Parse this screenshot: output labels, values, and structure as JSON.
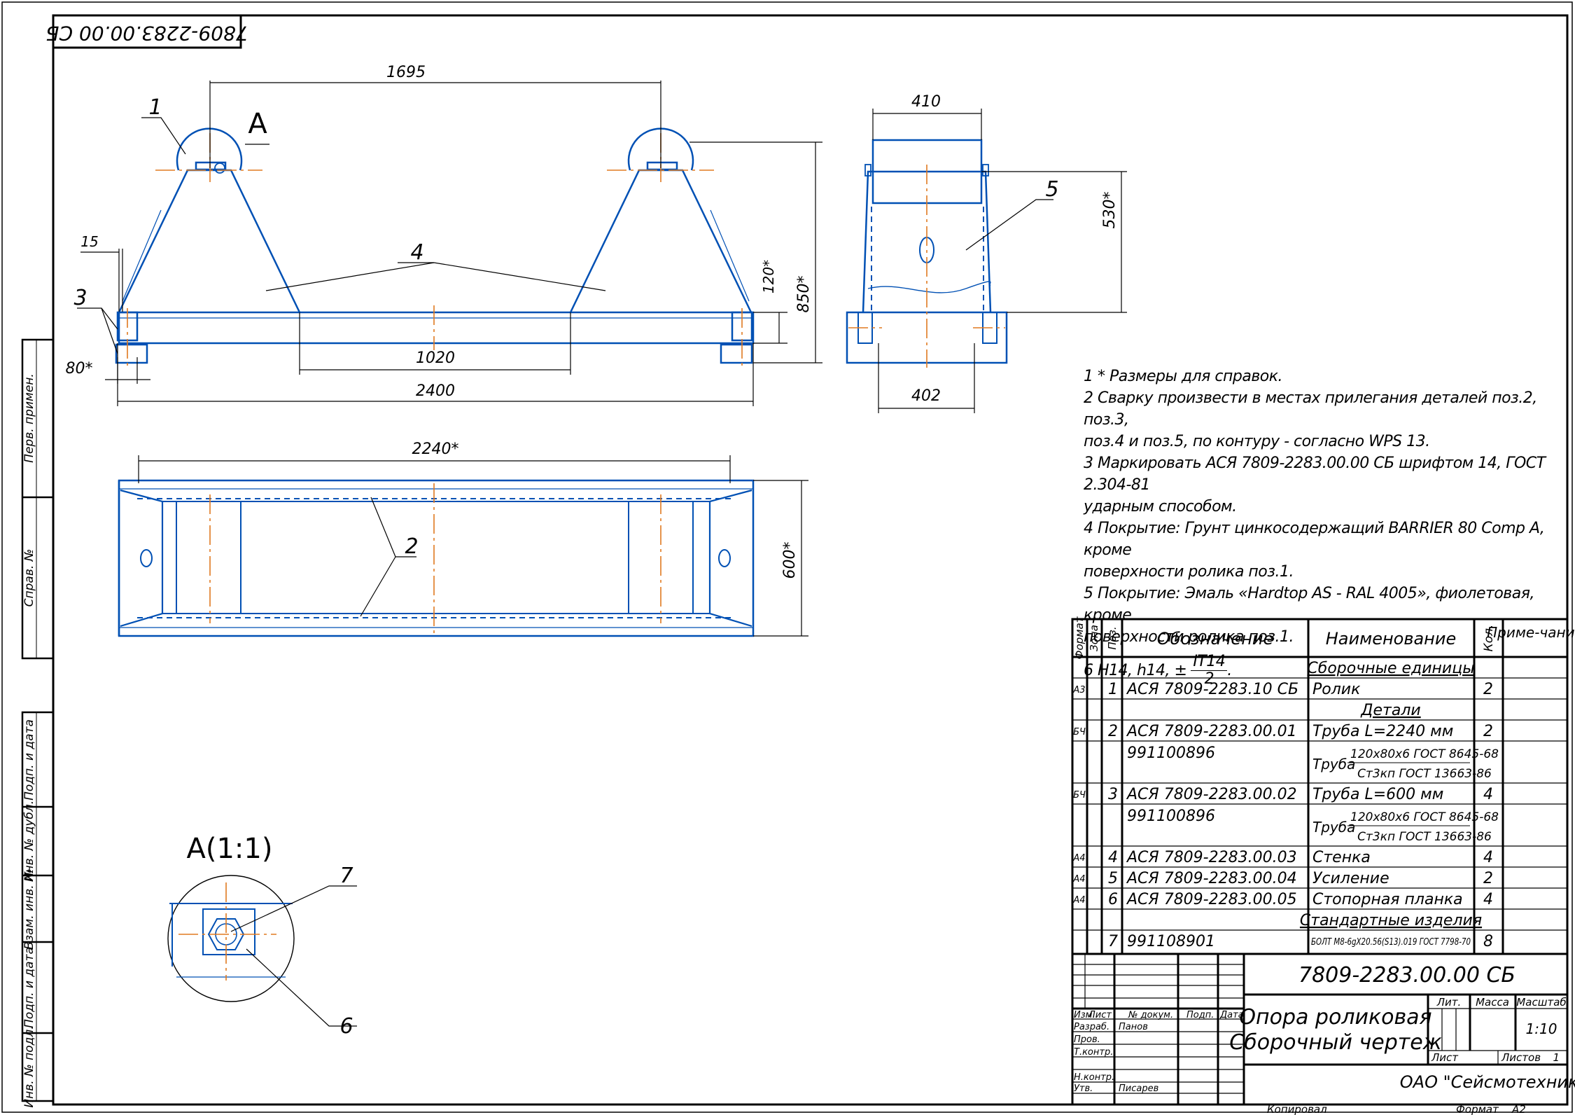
{
  "title_block": {
    "designation": "7809-2283.00.00 СБ",
    "name_line1": "Опора роликовая",
    "name_line2": "Сборочный чертеж",
    "company": "ОАО \"Сейсмотехника\"",
    "lit_label": "Лит.",
    "mass_label": "Масса",
    "scale_label": "Масштаб",
    "scale": "1:10",
    "sheet_label": "Лист",
    "sheets_label": "Листов",
    "sheets_count": "1",
    "izm": "Изм.",
    "list": "Лист",
    "doc_no": "№ докум.",
    "podp": "Подп.",
    "data": "Дата",
    "razrab": "Разраб.",
    "razrab_name": "Панов",
    "prov": "Пров.",
    "tkontr": "Т.контр.",
    "nkontr": "Н.контр.",
    "utv": "Утв.",
    "utv_name": "Писарев",
    "copied": "Копировал",
    "format_label": "Формат",
    "format": "А2"
  },
  "corner_stamp": "7809-2283.00.00 СБ",
  "side_stamps": [
    "Перв. примен.",
    "Справ. №",
    "Подп. и дата",
    "Инв. № дубл.",
    "Взам. инв. №",
    "Подп. и дата",
    "Инв. № подл."
  ],
  "dimensions": {
    "d1695": "1695",
    "d15": "15",
    "d80": "80*",
    "d1020": "1020",
    "d2400": "2400",
    "d120": "120*",
    "d850": "850*",
    "d410": "410",
    "d530": "530*",
    "d402": "402",
    "d2240": "2240*",
    "d600": "600*"
  },
  "callouts": {
    "p1": "1",
    "p2": "2",
    "p3": "3",
    "p4": "4",
    "p5": "5",
    "p6": "6",
    "p7": "7",
    "viewA": "А",
    "detailA": "А(1:1)"
  },
  "notes": [
    "1 * Размеры для справок.",
    "2 Сварку произвести в местах прилегания деталей поз.2, поз.3,",
    "поз.4 и поз.5, по контуру - согласно WPS 13.",
    "3 Маркировать АСЯ 7809-2283.00.00 СБ шрифтом 14, ГОСТ 2.304-81",
    "ударным способом.",
    "4 Покрытие: Грунт цинкосодержащий BARRIER 80 Comp A, кроме",
    "поверхности ролика поз.1.",
    "5 Покрытие: Эмаль «Hardtop AS - RAL 4005», фиолетовая, кроме",
    "поверхности ролика поз.1."
  ],
  "note6": {
    "prefix": "6 H14, h14, ±",
    "numerator": "IT14",
    "denominator": "2"
  },
  "spec": {
    "headers": {
      "format": "Формат",
      "zone": "Зона",
      "pos": "Поз.",
      "designation": "Обозначение",
      "name": "Наименование",
      "qty": "Кол.",
      "note": "Приме-чание"
    },
    "rows": [
      {
        "format": "",
        "pos": "",
        "designation": "",
        "name": "Сборочные единицы",
        "qty": "",
        "section": true
      },
      {
        "format": "А3",
        "pos": "1",
        "designation": "АСЯ 7809-2283.10 СБ",
        "name": "Ролик",
        "qty": "2"
      },
      {
        "format": "",
        "pos": "",
        "designation": "",
        "name": "Детали",
        "qty": "",
        "section": true
      },
      {
        "format": "БЧ",
        "pos": "2",
        "designation": "АСЯ 7809-2283.00.01",
        "name": "Труба L=2240 мм",
        "qty": "2"
      },
      {
        "format": "",
        "pos": "",
        "designation": "991100896",
        "name": "Труба",
        "frac_top": "120x80x6 ГОСТ 8645-68",
        "frac_bot": "Ст3кп ГОСТ 13663-86",
        "qty": "",
        "tall": true
      },
      {
        "format": "БЧ",
        "pos": "3",
        "designation": "АСЯ 7809-2283.00.02",
        "name": "Труба L=600 мм",
        "qty": "4"
      },
      {
        "format": "",
        "pos": "",
        "designation": "991100896",
        "name": "Труба",
        "frac_top": "120x80x6 ГОСТ 8645-68",
        "frac_bot": "Ст3кп ГОСТ 13663-86",
        "qty": "",
        "tall": true
      },
      {
        "format": "А4",
        "pos": "4",
        "designation": "АСЯ 7809-2283.00.03",
        "name": "Стенка",
        "qty": "4"
      },
      {
        "format": "А4",
        "pos": "5",
        "designation": "АСЯ 7809-2283.00.04",
        "name": "Усиление",
        "qty": "2"
      },
      {
        "format": "А4",
        "pos": "6",
        "designation": "АСЯ 7809-2283.00.05",
        "name": "Стопорная планка",
        "qty": "4"
      },
      {
        "format": "",
        "pos": "",
        "designation": "",
        "name": "Стандартные изделия",
        "qty": "",
        "section": true
      },
      {
        "format": "",
        "pos": "7",
        "designation": "991108901",
        "name": "БОЛТ М8-6gX20.56(S13).019 ГОСТ 7798-70",
        "qty": "8",
        "small": true
      }
    ]
  }
}
